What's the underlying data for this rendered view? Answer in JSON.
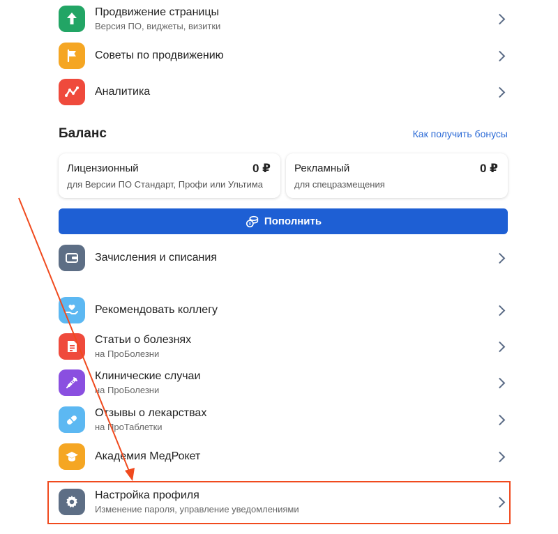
{
  "menu_top": [
    {
      "title": "Продвижение страницы",
      "subtitle": "Версия ПО, виджеты, визитки",
      "icon": "arrow-up-icon",
      "color": "#22a565"
    },
    {
      "title": "Советы по продвижению",
      "subtitle": "",
      "icon": "flag-icon",
      "color": "#f5a623"
    },
    {
      "title": "Аналитика",
      "subtitle": "",
      "icon": "analytics-icon",
      "color": "#ef4a3c"
    }
  ],
  "balance": {
    "heading": "Баланс",
    "bonus_link": "Как получить бонусы",
    "cards": [
      {
        "title": "Лицензионный",
        "value": "0 ₽",
        "subtitle": "для Версии ПО Стандарт, Профи или Ультима"
      },
      {
        "title": "Рекламный",
        "value": "0 ₽",
        "subtitle": "для спецразмещения"
      }
    ],
    "topup_label": "Пополнить"
  },
  "transactions": {
    "title": "Зачисления и списания",
    "icon": "wallet-icon",
    "color": "#5d6e85"
  },
  "menu_bottom": [
    {
      "title": "Рекомендовать коллегу",
      "subtitle": "",
      "icon": "heart-hand-icon",
      "color": "#5cb8f2"
    },
    {
      "title": "Статьи о болезнях",
      "subtitle": "на ПроБолезни",
      "icon": "article-icon",
      "color": "#ef4a3c"
    },
    {
      "title": "Клинические случаи",
      "subtitle": "на ПроБолезни",
      "icon": "syringe-icon",
      "color": "#8a4fe0"
    },
    {
      "title": "Отзывы о лекарствах",
      "subtitle": "на ПроТаблетки",
      "icon": "pill-icon",
      "color": "#5cb8f2"
    },
    {
      "title": "Академия МедРокет",
      "subtitle": "",
      "icon": "graduation-cap-icon",
      "color": "#f5a623"
    }
  ],
  "profile_settings": {
    "title": "Настройка профиля",
    "subtitle": "Изменение пароля, управление уведомлениями",
    "icon": "gear-icon",
    "color": "#5d6e85"
  },
  "annotation": {
    "color": "#f04a1e"
  }
}
